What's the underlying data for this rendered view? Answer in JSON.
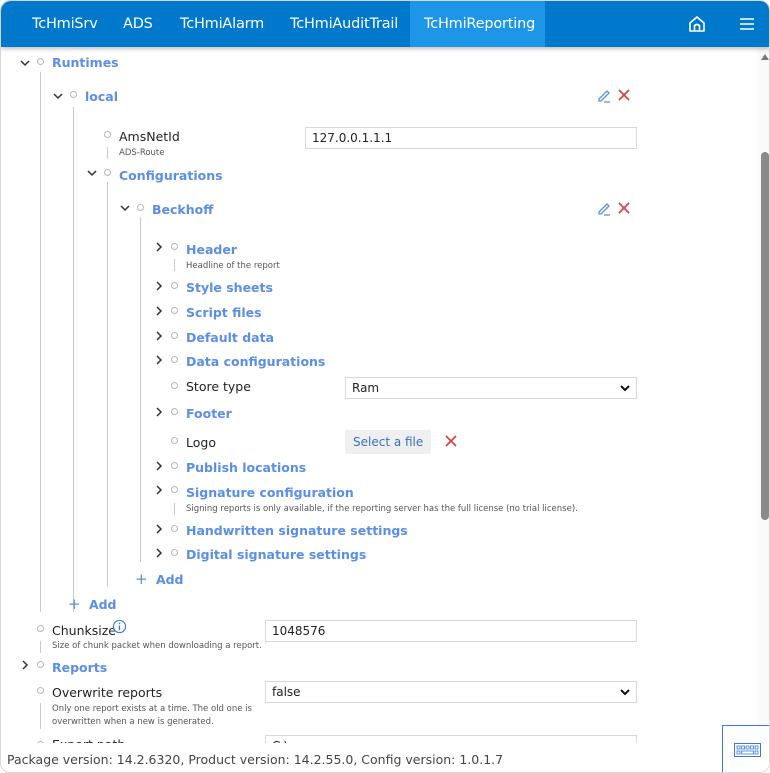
{
  "nav": {
    "tabs": [
      {
        "label": "TcHmiSrv",
        "active": false
      },
      {
        "label": "ADS",
        "active": false
      },
      {
        "label": "TcHmiAlarm",
        "active": false
      },
      {
        "label": "TcHmiAuditTrail",
        "active": false
      },
      {
        "label": "TcHmiReporting",
        "active": true
      }
    ],
    "icons": [
      "home-icon",
      "menu-icon"
    ]
  },
  "tree": {
    "runtimes": {
      "label": "Runtimes",
      "expanded": true
    },
    "local": {
      "label": "local",
      "expanded": true
    },
    "amsnetid": {
      "label": "AmsNetId",
      "description": "ADS-Route",
      "value": "127.0.0.1.1.1"
    },
    "configurations": {
      "label": "Configurations",
      "expanded": true
    },
    "beckhoff": {
      "label": "Beckhoff",
      "expanded": true
    },
    "beckhoff_children": [
      {
        "label": "Header",
        "description": "Headline of the report"
      },
      {
        "label": "Style sheets"
      },
      {
        "label": "Script files"
      },
      {
        "label": "Default data"
      },
      {
        "label": "Data configurations"
      },
      {
        "label": "Store type",
        "value": "Ram"
      },
      {
        "label": "Footer"
      },
      {
        "label": "Logo",
        "button": "Select a file"
      },
      {
        "label": "Publish locations"
      },
      {
        "label": "Signature configuration",
        "description": "Signing reports is only available, if the reporting server has the full license (no trial license)."
      },
      {
        "label": "Handwritten signature settings"
      },
      {
        "label": "Digital signature settings"
      }
    ],
    "add_configuration": "Add",
    "add_runtime": "Add",
    "chunksize": {
      "label": "Chunksize",
      "description": "Size of chunk packet when downloading a report.",
      "value": "1048576"
    },
    "reports": {
      "label": "Reports",
      "expanded": false
    },
    "overwrite_reports": {
      "label": "Overwrite reports",
      "description_line1": "Only one report exists at a time. The old one is",
      "description_line2": "overwritten when a new is generated.",
      "value": "false"
    },
    "export_path": {
      "label": "Export path",
      "value": "C:\\"
    }
  },
  "footer": {
    "version_text": "Package version: 14.2.6320, Product version: 14.2.55.0, Config version: 1.0.1.7"
  },
  "colors": {
    "nav_bg": "#0079cc",
    "nav_active": "#1e96e8",
    "link": "#5b8ee6",
    "delete": "#e03a3a"
  }
}
